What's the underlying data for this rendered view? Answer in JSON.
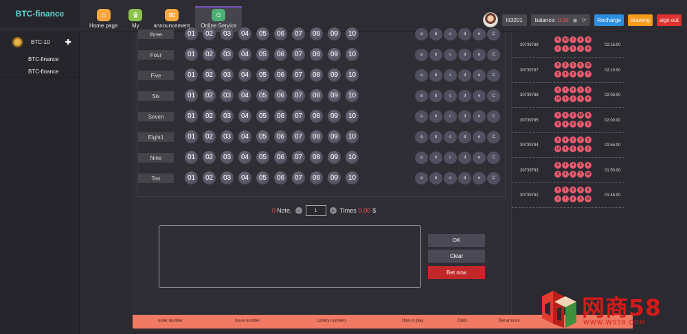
{
  "brand": "BTC-finance",
  "nav": [
    {
      "label": "Home page",
      "icon": "home-icon",
      "color": "#f7a640"
    },
    {
      "label": "My",
      "icon": "crown-icon",
      "color": "#8bc34a"
    },
    {
      "label": "announcement",
      "icon": "mail-icon",
      "color": "#f7a640"
    },
    {
      "label": "Online Service",
      "icon": "user-icon",
      "color": "#4caf75"
    }
  ],
  "user": {
    "username": "ltt3201",
    "balance_label": "balance:",
    "balance_value": "0.00",
    "recharge": "Recharge",
    "drawing": "drawing",
    "signout": "sign out"
  },
  "sidebar": {
    "game": "BTC-10",
    "subitems": [
      "BTC-finance",
      "BTC-finance"
    ]
  },
  "rows": [
    {
      "label": "three"
    },
    {
      "label": "Four"
    },
    {
      "label": "Five"
    },
    {
      "label": "Six"
    },
    {
      "label": "Seven"
    },
    {
      "label": "Eight1"
    },
    {
      "label": "Nine"
    },
    {
      "label": "Ten"
    }
  ],
  "numbers": [
    "01",
    "02",
    "03",
    "04",
    "05",
    "06",
    "07",
    "08",
    "09",
    "10"
  ],
  "picks": [
    "a",
    "b",
    "c",
    "d",
    "e",
    "C"
  ],
  "bet": {
    "notes": "0",
    "note_label": "Note,",
    "quantity": "1",
    "times_label": "Times",
    "amount": "0.00",
    "currency": "$"
  },
  "actions": {
    "ok": "OK",
    "clear": "Clear",
    "bet": "Bet now"
  },
  "history": [
    {
      "issue": "30739788",
      "time": "02:15:00",
      "balls": [
        [
          "6",
          "10",
          "7",
          "8",
          "9"
        ],
        [
          "2",
          "1",
          "5",
          "3",
          "4"
        ]
      ]
    },
    {
      "issue": "30739787",
      "time": "02:10:00",
      "balls": [
        [
          "9",
          "5",
          "1",
          "6",
          "10"
        ],
        [
          "2",
          "8",
          "3",
          "4",
          "7"
        ]
      ]
    },
    {
      "issue": "30739786",
      "time": "02:05:00",
      "balls": [
        [
          "2",
          "7",
          "4",
          "1",
          "9"
        ],
        [
          "10",
          "8",
          "3",
          "5",
          "6"
        ]
      ]
    },
    {
      "issue": "30739785",
      "time": "02:00:00",
      "balls": [
        [
          "1",
          "5",
          "2",
          "10",
          "8"
        ],
        [
          "9",
          "4",
          "6",
          "7",
          "3"
        ]
      ]
    },
    {
      "issue": "30739784",
      "time": "01:55:00",
      "balls": [
        [
          "9",
          "4",
          "1",
          "9",
          "2"
        ],
        [
          "10",
          "8",
          "5",
          "6",
          "3"
        ]
      ]
    },
    {
      "issue": "30739783",
      "time": "01:50:00",
      "balls": [
        [
          "9",
          "5",
          "4",
          "2",
          "8"
        ],
        [
          "3",
          "6",
          "1",
          "7",
          "10"
        ]
      ]
    },
    {
      "issue": "30739782",
      "time": "01:45:00",
      "balls": [
        [
          "4",
          "3",
          "9",
          "8",
          "6"
        ],
        [
          "1",
          "7",
          "2",
          "5",
          "10"
        ]
      ]
    }
  ],
  "bottom_headers": [
    "order number",
    "Issue number",
    "Lottery numbers",
    "How to play",
    "Odds",
    "Bet amount"
  ],
  "watermark": {
    "text": "网商58",
    "url": "WWW.WS58.COM"
  }
}
